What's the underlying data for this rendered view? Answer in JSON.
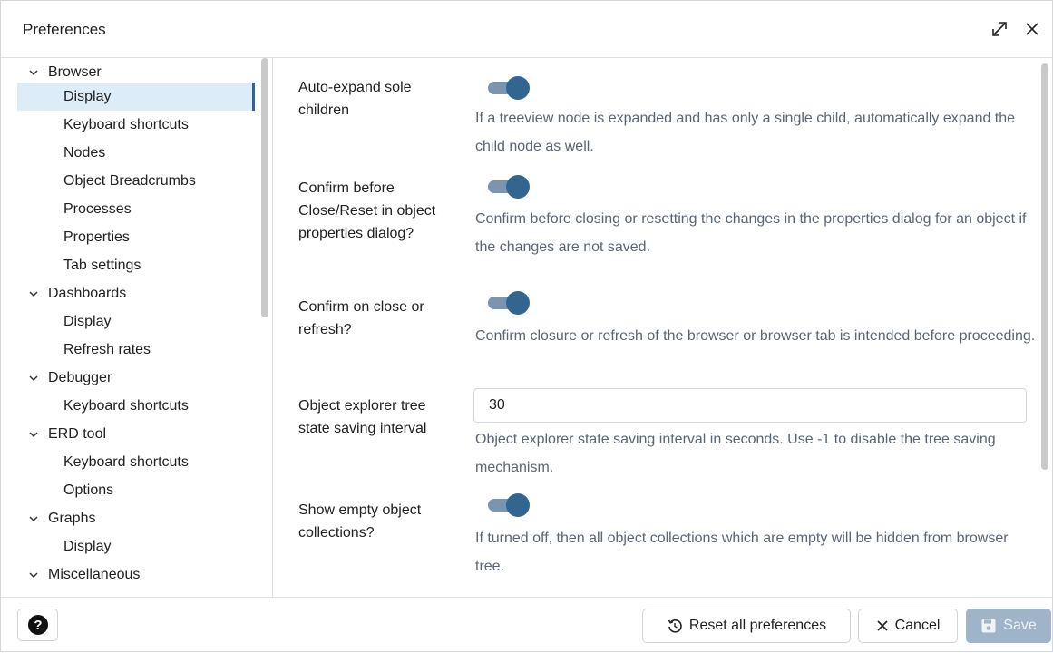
{
  "window": {
    "title": "Preferences",
    "maximize_icon": "maximize-icon",
    "close_icon": "close-icon"
  },
  "sidebar": {
    "items": [
      {
        "label": "Browser",
        "level": "parent",
        "expanded": true
      },
      {
        "label": "Display",
        "level": "child",
        "selected": true
      },
      {
        "label": "Keyboard shortcuts",
        "level": "child"
      },
      {
        "label": "Nodes",
        "level": "child"
      },
      {
        "label": "Object Breadcrumbs",
        "level": "child"
      },
      {
        "label": "Processes",
        "level": "child"
      },
      {
        "label": "Properties",
        "level": "child"
      },
      {
        "label": "Tab settings",
        "level": "child"
      },
      {
        "label": "Dashboards",
        "level": "parent",
        "expanded": true
      },
      {
        "label": "Display",
        "level": "child"
      },
      {
        "label": "Refresh rates",
        "level": "child"
      },
      {
        "label": "Debugger",
        "level": "parent",
        "expanded": true
      },
      {
        "label": "Keyboard shortcuts",
        "level": "child"
      },
      {
        "label": "ERD tool",
        "level": "parent",
        "expanded": true
      },
      {
        "label": "Keyboard shortcuts",
        "level": "child"
      },
      {
        "label": "Options",
        "level": "child"
      },
      {
        "label": "Graphs",
        "level": "parent",
        "expanded": true
      },
      {
        "label": "Display",
        "level": "child"
      },
      {
        "label": "Miscellaneous",
        "level": "parent",
        "expanded": true
      }
    ]
  },
  "preferences": [
    {
      "label": "Auto-expand sole children",
      "type": "toggle",
      "value": true,
      "help": "If a treeview node is expanded and has only a single child, automatically expand the child node as well."
    },
    {
      "label": "Confirm before Close/Reset in object properties dialog?",
      "type": "toggle",
      "value": true,
      "help": "Confirm before closing or resetting the changes in the properties dialog for an object if the changes are not saved."
    },
    {
      "label": "Confirm on close or refresh?",
      "type": "toggle",
      "value": true,
      "help": "Confirm closure or refresh of the browser or browser tab is intended before proceeding."
    },
    {
      "label": "Object explorer tree state saving interval",
      "type": "number",
      "value": "30",
      "help": "Object explorer state saving interval in seconds. Use -1 to disable the tree saving mechanism."
    },
    {
      "label": "Show empty object collections?",
      "type": "toggle",
      "value": true,
      "help": "If turned off, then all object collections which are empty will be hidden from browser tree."
    }
  ],
  "footer": {
    "help_icon": "help-circle-icon",
    "reset_label": "Reset all preferences",
    "reset_icon": "reset-icon",
    "cancel_label": "Cancel",
    "cancel_icon": "close-icon",
    "save_label": "Save",
    "save_icon": "save-icon"
  },
  "colors": {
    "accent": "#326690",
    "toggle_track": "#7b94b0",
    "selected_bg": "#dcecf8",
    "save_disabled": "#9fb4c8",
    "help_text": "#5b6674"
  }
}
